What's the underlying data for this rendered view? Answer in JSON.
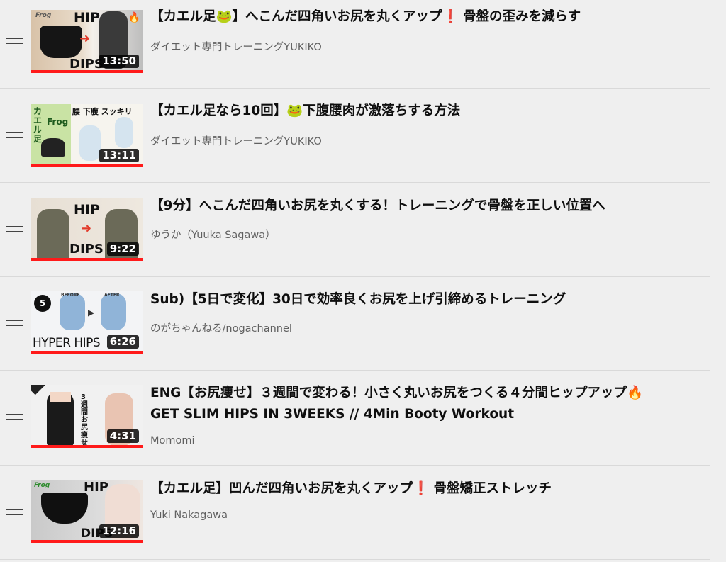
{
  "playlist": {
    "items": [
      {
        "title": "【カエル足🐸】へこんだ四角いお尻を丸くアップ❗ 骨盤の歪みを減らす",
        "channel": "ダイエット専門トレーニングYUKIKO",
        "duration": "13:50",
        "thumb_text": [
          "Frog",
          "HIP",
          "DIPS"
        ]
      },
      {
        "title": "【カエル足なら10回】🐸下腹腰肉が激落ちする方法",
        "channel": "ダイエット専門トレーニングYUKIKO",
        "duration": "13:11",
        "thumb_text": [
          "カエル足",
          "Frog",
          "腰 下腹 スッキリ"
        ]
      },
      {
        "title": "【9分】へこんだ四角いお尻を丸くする！トレーニングで骨盤を正しい位置へ",
        "channel": "ゆうか（Yuuka Sagawa）",
        "duration": "9:22",
        "thumb_text": [
          "HIP",
          "DIPS"
        ]
      },
      {
        "title": "Sub)【5日で変化】30日で効率良くお尻を上げ引締めるトレーニング",
        "channel": "のがちゃんねる/nogachannel",
        "duration": "6:26",
        "thumb_text": [
          "5",
          "BEFORE",
          "AFTER",
          "HYPER HIPS"
        ]
      },
      {
        "title_line1": "ENG【お尻痩せ】３週間で変わる！小さく丸いお尻をつくる４分間ヒップアップ🔥",
        "title_line2": "GET SLIM HIPS IN 3WEEKS // 4Min Booty Workout",
        "channel": "Momomi",
        "duration": "4:31",
        "thumb_text": [
          "3週間",
          "お尻痩せ"
        ]
      },
      {
        "title": "【カエル足】凹んだ四角いお尻を丸くアップ❗ 骨盤矯正ストレッチ",
        "channel": "Yuki Nakagawa",
        "duration": "12:16",
        "thumb_text": [
          "Frog",
          "HIP",
          "DIPS"
        ]
      }
    ]
  },
  "colors": {
    "progress": "#ff1a1a",
    "background": "#efefef",
    "channel_text": "#606060"
  },
  "icons": [
    "drag-handle-icon"
  ]
}
